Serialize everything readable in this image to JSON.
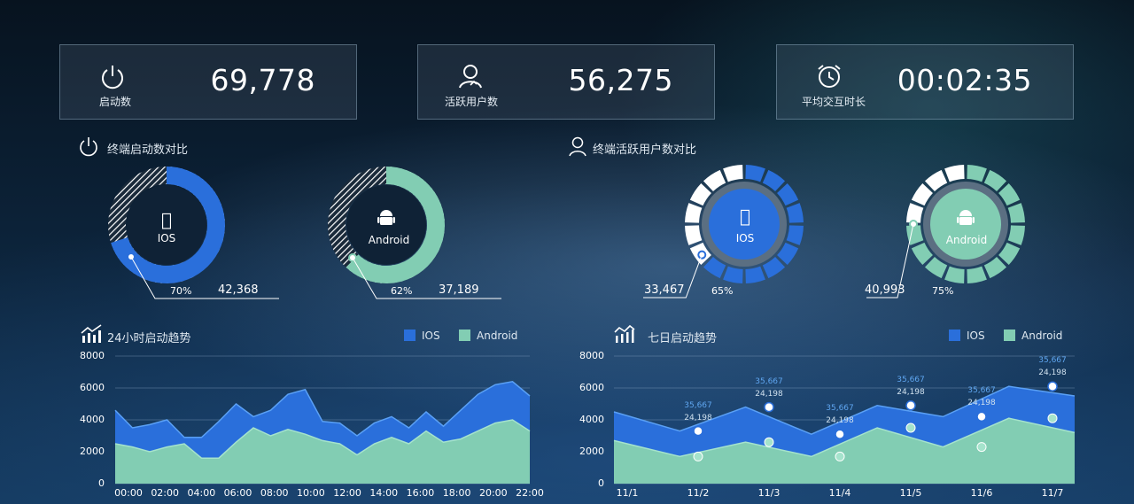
{
  "stats": [
    {
      "label": "启动数",
      "value": "69,778",
      "icon": "power-icon"
    },
    {
      "label": "活跃用户数",
      "value": "56,275",
      "icon": "user-icon"
    },
    {
      "label": "平均交互时长",
      "value": "00:02:35",
      "icon": "alarm-clock-icon"
    }
  ],
  "sections": {
    "launch_compare": "终端启动数对比",
    "active_compare": "终端活跃用户数对比",
    "trend_24h": "24小时启动趋势",
    "trend_7d": "七日启动趋势"
  },
  "rings": [
    {
      "name": "IOS",
      "pct": "70%",
      "count": "42,368",
      "color": "#2a6fdb"
    },
    {
      "name": "Android",
      "pct": "62%",
      "count": "37,189",
      "color": "#82cdb3"
    },
    {
      "name": "IOS",
      "pct": "65%",
      "count": "33,467",
      "color": "#2a6fdb"
    },
    {
      "name": "Android",
      "pct": "75%",
      "count": "40,993",
      "color": "#82cdb3"
    }
  ],
  "legend": {
    "ios": "IOS",
    "android": "Android"
  },
  "colors": {
    "ios": "#2a6fdb",
    "android": "#82cdb3"
  },
  "chart_data": [
    {
      "type": "area",
      "title": "24小时启动趋势",
      "x_ticks": [
        "00:00",
        "02:00",
        "04:00",
        "06:00",
        "08:00",
        "10:00",
        "12:00",
        "14:00",
        "16:00",
        "18:00",
        "20:00",
        "22:00"
      ],
      "ylim": [
        0,
        8000
      ],
      "y_ticks": [
        "8000",
        "6000",
        "4000",
        "2000",
        "0"
      ],
      "x": [
        0,
        1,
        2,
        3,
        4,
        5,
        6,
        7,
        8,
        9,
        10,
        11,
        12,
        13,
        14,
        15,
        16,
        17,
        18,
        19,
        20,
        21,
        22,
        23
      ],
      "series": [
        {
          "name": "IOS",
          "values": [
            4600,
            3500,
            3700,
            4000,
            2900,
            2900,
            3900,
            5000,
            4200,
            4600,
            5600,
            5900,
            3900,
            3800,
            3000,
            3800,
            4200,
            3500,
            4500,
            3600,
            4600,
            5600,
            6200,
            6400,
            5500
          ]
        },
        {
          "name": "Android",
          "values": [
            2500,
            2300,
            2000,
            2300,
            2500,
            1600,
            1600,
            2600,
            3500,
            3000,
            3400,
            3100,
            2700,
            2500,
            1800,
            2500,
            2900,
            2500,
            3300,
            2600,
            2800,
            3300,
            3800,
            4000,
            3300
          ]
        }
      ]
    },
    {
      "type": "area",
      "title": "七日启动趋势",
      "categories": [
        "11/1",
        "11/2",
        "11/3",
        "11/4",
        "11/5",
        "11/6",
        "11/7"
      ],
      "ylim": [
        0,
        8000
      ],
      "y_ticks": [
        "8000",
        "6000",
        "4000",
        "2000",
        "0"
      ],
      "series": [
        {
          "name": "IOS",
          "values": [
            4500,
            3300,
            4800,
            3100,
            4900,
            4200,
            6100,
            5500
          ]
        },
        {
          "name": "Android",
          "values": [
            2700,
            1700,
            2600,
            1700,
            3500,
            2300,
            4100,
            3200
          ]
        }
      ],
      "point_labels": [
        {
          "top": "35,667",
          "bottom": "24,198"
        },
        {
          "top": "35,667",
          "bottom": "24,198"
        },
        {
          "top": "35,667",
          "bottom": "24,198"
        },
        {
          "top": "35,667",
          "bottom": "24,198"
        },
        {
          "top": "35,667",
          "bottom": "24,198"
        },
        {
          "top": "35,667",
          "bottom": "24,198"
        }
      ]
    }
  ]
}
